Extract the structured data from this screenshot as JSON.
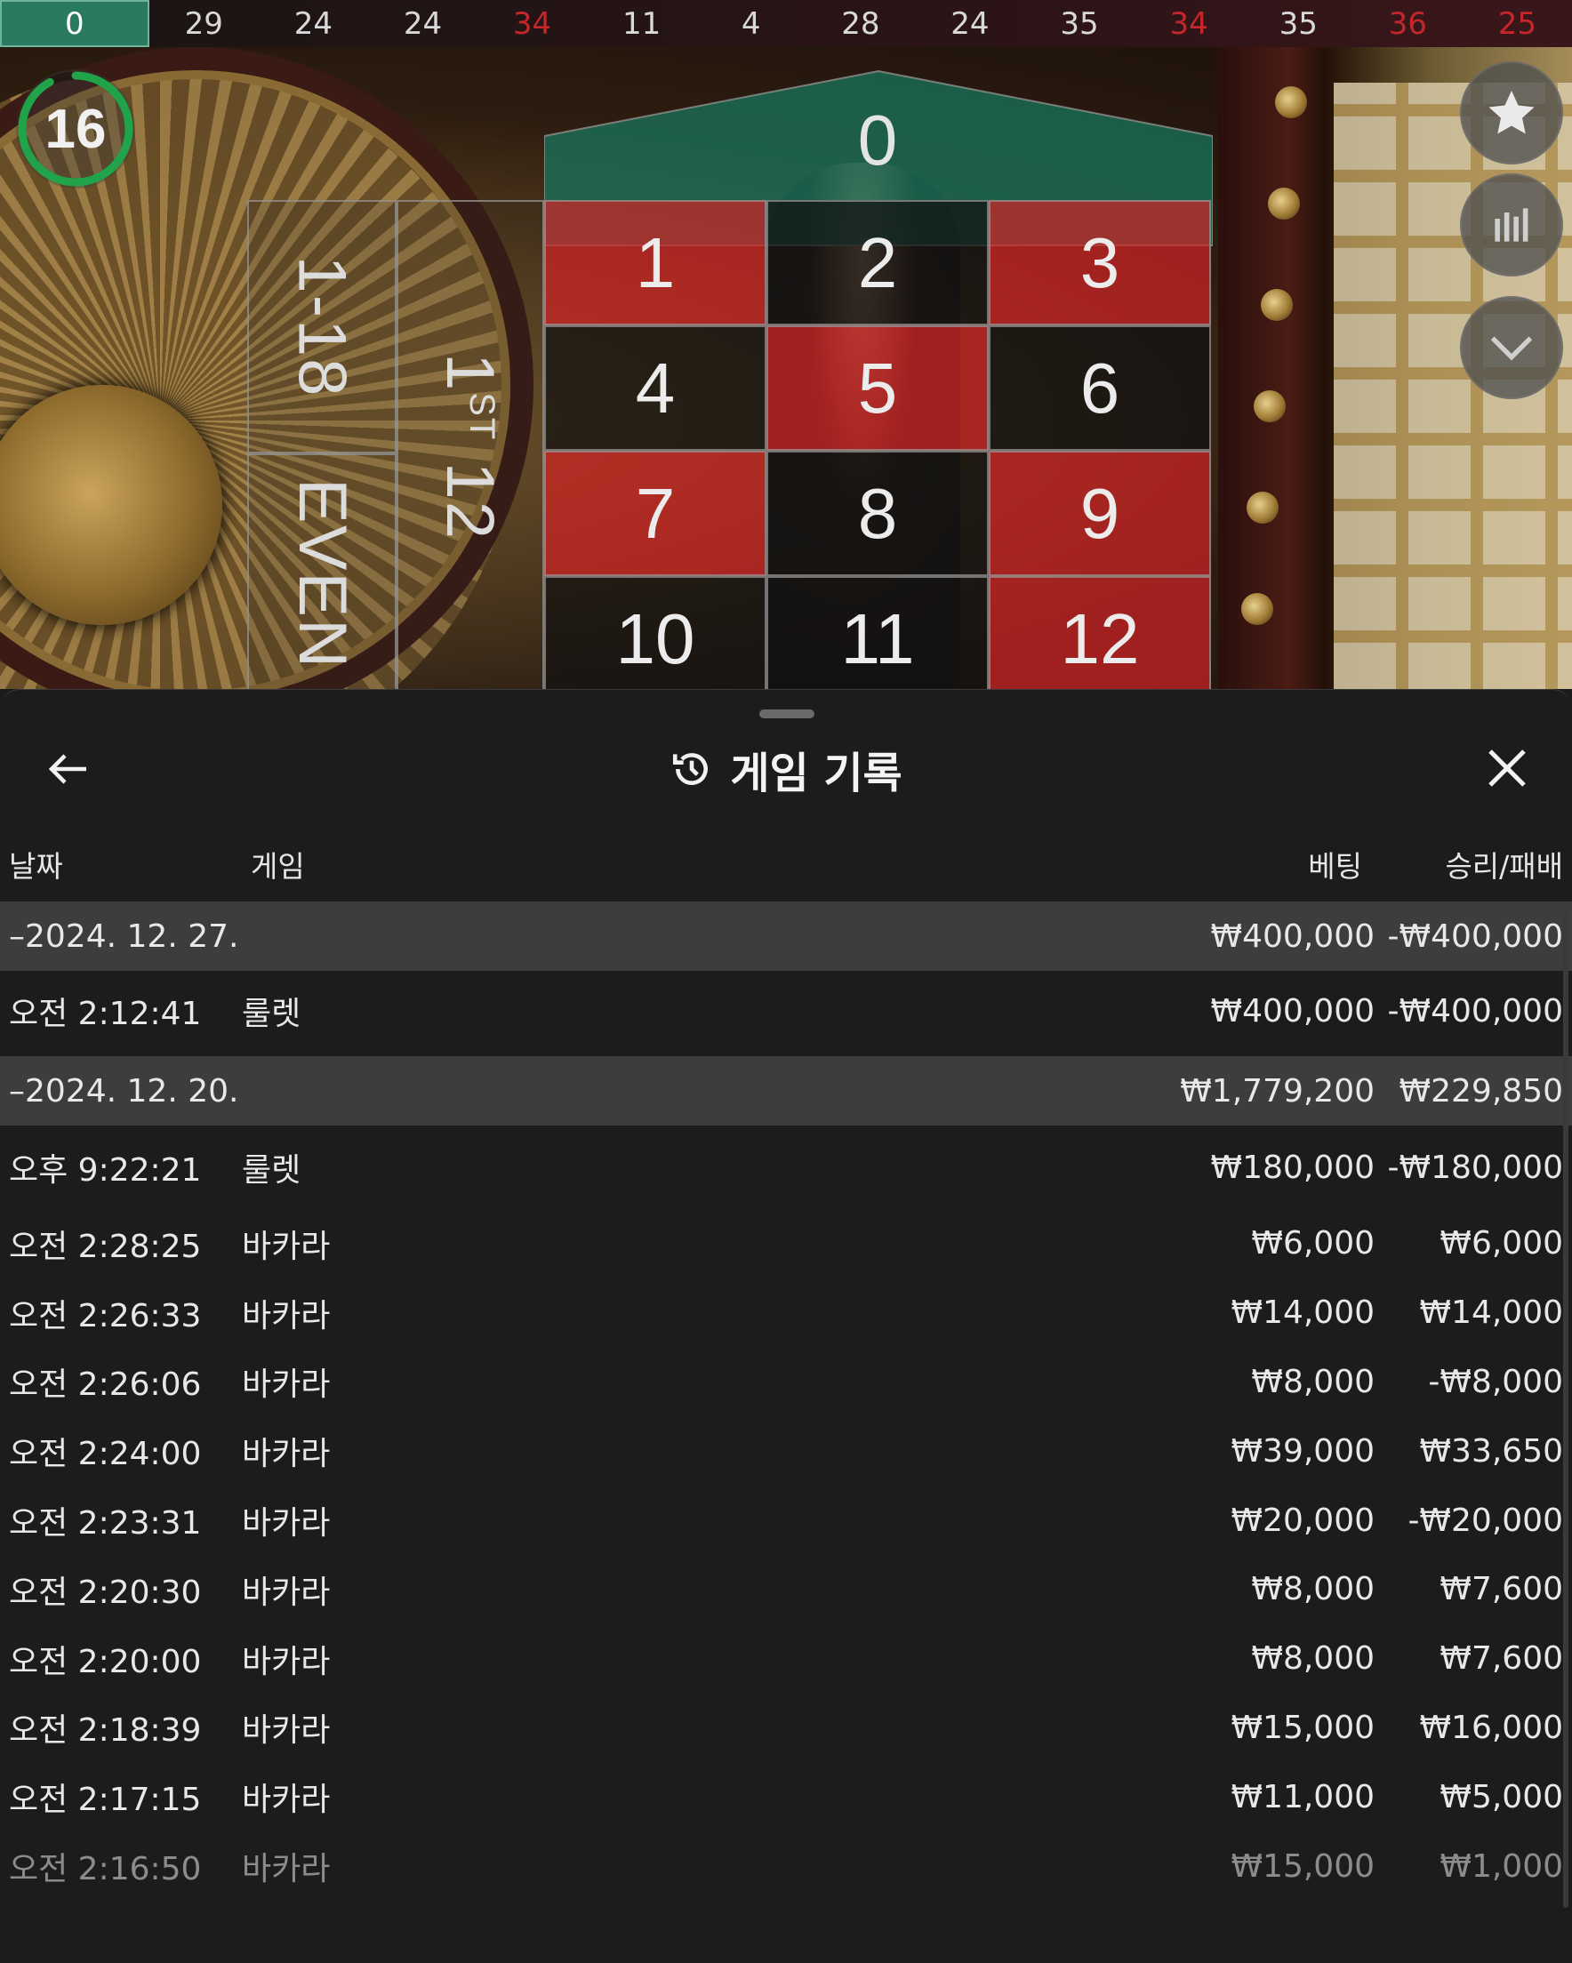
{
  "history_strip": [
    {
      "n": "0",
      "c": "green"
    },
    {
      "n": "29",
      "c": "black"
    },
    {
      "n": "24",
      "c": "black"
    },
    {
      "n": "24",
      "c": "black"
    },
    {
      "n": "34",
      "c": "red"
    },
    {
      "n": "11",
      "c": "black"
    },
    {
      "n": "4",
      "c": "black"
    },
    {
      "n": "28",
      "c": "black"
    },
    {
      "n": "24",
      "c": "black"
    },
    {
      "n": "35",
      "c": "black"
    },
    {
      "n": "34",
      "c": "red"
    },
    {
      "n": "35",
      "c": "black"
    },
    {
      "n": "36",
      "c": "red"
    },
    {
      "n": "25",
      "c": "red"
    }
  ],
  "timer": {
    "seconds": "16",
    "progress": 0.92
  },
  "board": {
    "zero": "0",
    "numbers": [
      {
        "n": "1",
        "c": "red"
      },
      {
        "n": "2",
        "c": "black"
      },
      {
        "n": "3",
        "c": "red"
      },
      {
        "n": "4",
        "c": "black"
      },
      {
        "n": "5",
        "c": "red"
      },
      {
        "n": "6",
        "c": "black"
      },
      {
        "n": "7",
        "c": "red"
      },
      {
        "n": "8",
        "c": "black"
      },
      {
        "n": "9",
        "c": "red"
      },
      {
        "n": "10",
        "c": "black"
      },
      {
        "n": "11",
        "c": "black"
      },
      {
        "n": "12",
        "c": "red"
      }
    ],
    "low_bet": "1-18",
    "even_bet": "EVEN",
    "dozen_prefix": "1",
    "dozen_suffix": "ST",
    "dozen_number": "12"
  },
  "side_buttons": [
    "star-icon",
    "stats-icon",
    "chevron-down-icon"
  ],
  "sheet": {
    "title": "게임 기록",
    "columns": {
      "date": "날짜",
      "game": "게임",
      "bet": "베팅",
      "result": "승리/패배"
    },
    "groups": [
      {
        "date": "–2024. 12. 27.",
        "bet": "₩400,000",
        "result": "-₩400,000",
        "rows": [
          {
            "time": "오전 2:12:41",
            "game": "룰렛",
            "bet": "₩400,000",
            "result": "-₩400,000"
          }
        ]
      },
      {
        "date": "–2024. 12. 20.",
        "bet": "₩1,779,200",
        "result": "₩229,850",
        "rows": [
          {
            "time": "오후 9:22:21",
            "game": "룰렛",
            "bet": "₩180,000",
            "result": "-₩180,000"
          },
          {
            "time": "오전 2:28:25",
            "game": "바카라",
            "bet": "₩6,000",
            "result": "₩6,000"
          },
          {
            "time": "오전 2:26:33",
            "game": "바카라",
            "bet": "₩14,000",
            "result": "₩14,000"
          },
          {
            "time": "오전 2:26:06",
            "game": "바카라",
            "bet": "₩8,000",
            "result": "-₩8,000"
          },
          {
            "time": "오전 2:24:00",
            "game": "바카라",
            "bet": "₩39,000",
            "result": "₩33,650"
          },
          {
            "time": "오전 2:23:31",
            "game": "바카라",
            "bet": "₩20,000",
            "result": "-₩20,000"
          },
          {
            "time": "오전 2:20:30",
            "game": "바카라",
            "bet": "₩8,000",
            "result": "₩7,600"
          },
          {
            "time": "오전 2:20:00",
            "game": "바카라",
            "bet": "₩8,000",
            "result": "₩7,600"
          },
          {
            "time": "오전 2:18:39",
            "game": "바카라",
            "bet": "₩15,000",
            "result": "₩16,000"
          },
          {
            "time": "오전 2:17:15",
            "game": "바카라",
            "bet": "₩11,000",
            "result": "₩5,000"
          },
          {
            "time": "오전 2:16:50",
            "game": "바카라",
            "bet": "₩15,000",
            "result": "₩1,000"
          }
        ]
      }
    ]
  },
  "colors": {
    "red": "#c3272b",
    "green": "#2a7a62",
    "timer_ring": "#21a34a",
    "sheet_bg": "#1c1c1c",
    "group_row": "#3d3d3d"
  }
}
